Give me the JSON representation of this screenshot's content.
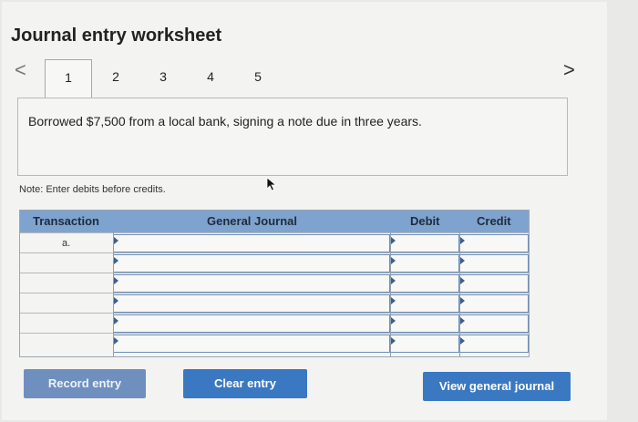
{
  "title": "Journal entry worksheet",
  "nav": {
    "prev": "<",
    "next": ">"
  },
  "tabs": [
    {
      "label": "1",
      "active": true
    },
    {
      "label": "2",
      "active": false
    },
    {
      "label": "3",
      "active": false
    },
    {
      "label": "4",
      "active": false
    },
    {
      "label": "5",
      "active": false
    }
  ],
  "description": "Borrowed $7,500 from a local bank, signing a note due in three years.",
  "note": "Note: Enter debits before credits.",
  "table": {
    "headers": {
      "transaction": "Transaction",
      "general_journal": "General Journal",
      "debit": "Debit",
      "credit": "Credit"
    },
    "rows": [
      {
        "transaction": "a.",
        "account": "",
        "debit": "",
        "credit": ""
      },
      {
        "transaction": "",
        "account": "",
        "debit": "",
        "credit": ""
      },
      {
        "transaction": "",
        "account": "",
        "debit": "",
        "credit": ""
      },
      {
        "transaction": "",
        "account": "",
        "debit": "",
        "credit": ""
      },
      {
        "transaction": "",
        "account": "",
        "debit": "",
        "credit": ""
      },
      {
        "transaction": "",
        "account": "",
        "debit": "",
        "credit": ""
      }
    ]
  },
  "buttons": {
    "record": "Record entry",
    "clear": "Clear entry",
    "view": "View general journal"
  },
  "colors": {
    "header_bg": "#7fa3cf",
    "button_bg": "#3a78c2",
    "button_disabled_bg": "#6f90bf"
  }
}
